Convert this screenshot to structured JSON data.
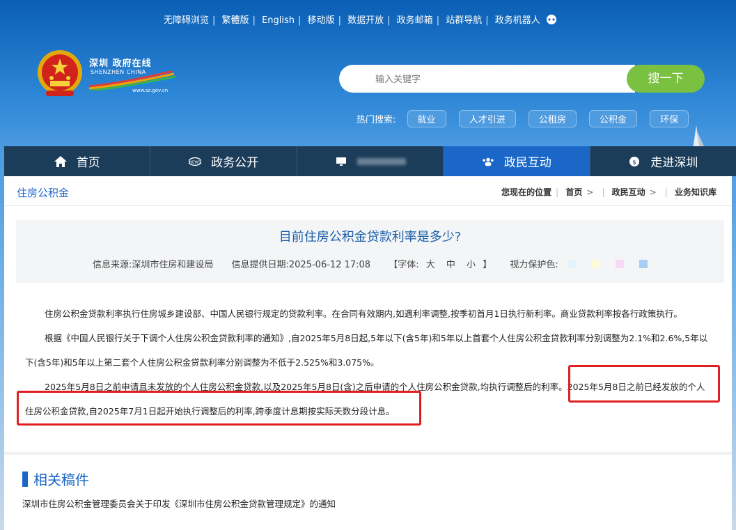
{
  "topbar": {
    "links": [
      "无障碍浏览",
      "繁體版",
      "English",
      "移动版",
      "数据开放",
      "政务邮箱",
      "站群导航",
      "政务机器人"
    ]
  },
  "logo": {
    "cn_text": "深圳 政府在线",
    "en_text": "SHENZHEN CHINA",
    "url": "www.sz.gov.cn"
  },
  "search": {
    "placeholder": "输入关键字",
    "button_label": "搜一下"
  },
  "hot_search": {
    "label": "热门搜索:",
    "tags": [
      "就业",
      "人才引进",
      "公租房",
      "公积金",
      "环保"
    ]
  },
  "nav": {
    "items": [
      {
        "label": "首页",
        "icon": "home-icon"
      },
      {
        "label": "政务公开",
        "icon": "news-icon"
      },
      {
        "label": "",
        "icon": "monitor-icon"
      },
      {
        "label": "政民互动",
        "icon": "users-icon",
        "active": true
      },
      {
        "label": "走进深圳",
        "icon": "coin-icon"
      }
    ]
  },
  "section": {
    "name": "住房公积金"
  },
  "breadcrumb": {
    "label": "您现在的位置",
    "items": [
      "首页",
      "政民互动",
      "业务知识库"
    ]
  },
  "article": {
    "title": "目前住房公积金贷款利率是多少?",
    "source": "信息来源:深圳市住房和建设局",
    "date": "信息提供日期:2025-06-12 17:08",
    "font_label": "【字体:",
    "font_sizes": [
      "大",
      "中",
      "小"
    ],
    "font_close": "】",
    "eye_label": "视力保护色:",
    "eye_colors": [
      "#e3f4fb",
      "#fbfbd8",
      "#f7d9f7",
      "#a9cdf5"
    ],
    "paragraphs": [
      "住房公积金贷款利率执行住房城乡建设部、中国人民银行规定的贷款利率。在合同有效期内,如遇利率调整,按季初首月1日执行新利率。商业贷款利率按各行政策执行。",
      "根据《中国人民银行关于下调个人住房公积金贷款利率的通知》,自2025年5月8日起,5年以下(含5年)和5年以上首套个人住房公积金贷款利率分别调整为2.1%和2.6%,5年以下(含5年)和5年以上第二套个人住房公积金贷款利率分别调整为不低于2.525%和3.075%。",
      "2025年5月8日之前申请且未发放的个人住房公积金贷款,以及2025年5月8日(含)之后申请的个人住房公积金贷款,均执行调整后的利率。2025年5月8日之前已经发放的个人住房公积金贷款,自2025年7月1日起开始执行调整后的利率,跨季度计息期按实际天数分段计息。"
    ]
  },
  "related": {
    "title": "相关稿件",
    "link": "深圳市住房公积金管理委员会关于印发《深圳市住房公积金贷款管理规定》的通知"
  }
}
